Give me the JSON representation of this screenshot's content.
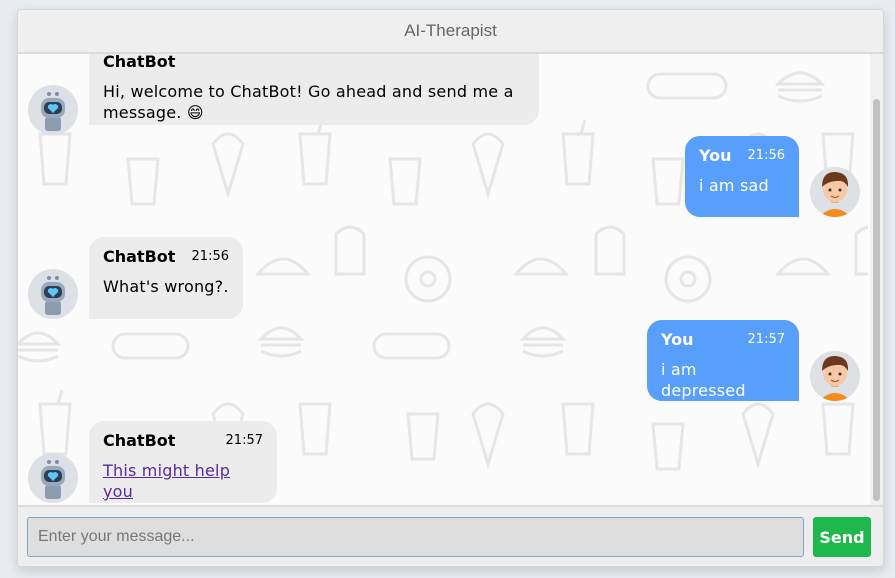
{
  "window": {
    "title": "AI-Therapist"
  },
  "messages": [
    {
      "side": "left",
      "name": "ChatBot",
      "time": "",
      "text": "Hi, welcome to ChatBot! Go ahead and send me a message. 😄",
      "link": false
    },
    {
      "side": "right",
      "name": "You",
      "time": "21:56",
      "text": "i am sad",
      "link": false
    },
    {
      "side": "left",
      "name": "ChatBot",
      "time": "21:56",
      "text": "What's wrong?.",
      "link": false
    },
    {
      "side": "right",
      "name": "You",
      "time": "21:57",
      "text": "i am depressed",
      "link": false
    },
    {
      "side": "left",
      "name": "ChatBot",
      "time": "21:57",
      "text": "This might help you",
      "link": true
    }
  ],
  "composer": {
    "placeholder": "Enter your message...",
    "value": "",
    "send_label": "Send"
  },
  "colors": {
    "user_bubble": "#579ffb",
    "bot_bubble": "#ececec",
    "send_button": "#1fb84c"
  },
  "icons": {
    "bot_avatar": "robot-avatar-icon",
    "user_avatar": "boy-avatar-icon"
  }
}
